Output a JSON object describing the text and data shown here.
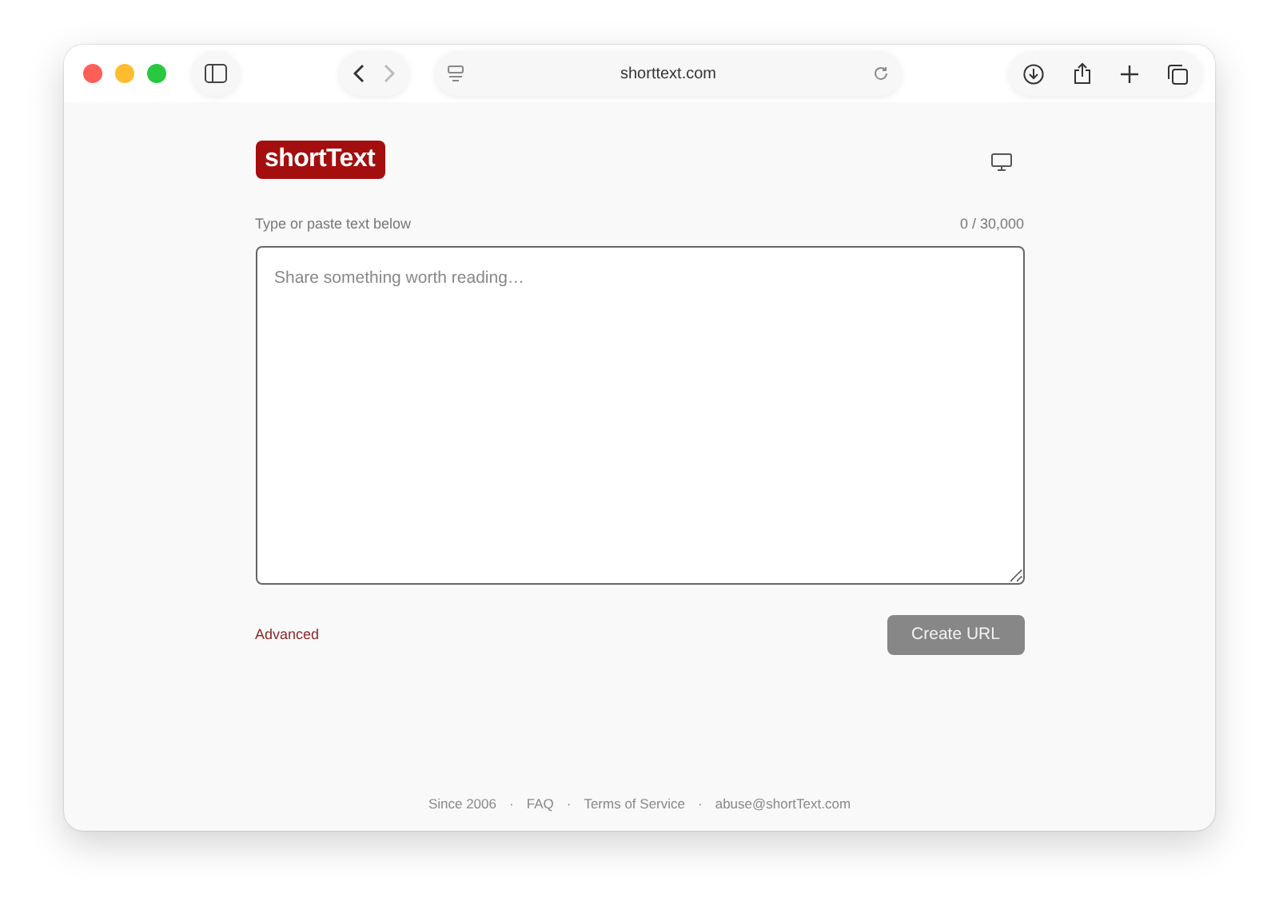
{
  "browser": {
    "address": "shorttext.com",
    "back_disabled": false,
    "forward_disabled": true
  },
  "page": {
    "logo": "shortText",
    "editor": {
      "label": "Type or paste text below",
      "counter": "0 / 30,000",
      "placeholder": "Share something worth reading…"
    },
    "advanced_link": "Advanced",
    "create_button": {
      "label": "Create URL",
      "disabled": true
    },
    "footer": {
      "separator": "·",
      "since": "Since 2006",
      "links": [
        "FAQ",
        "Terms of Service",
        "abuse@shortText.com"
      ]
    }
  }
}
